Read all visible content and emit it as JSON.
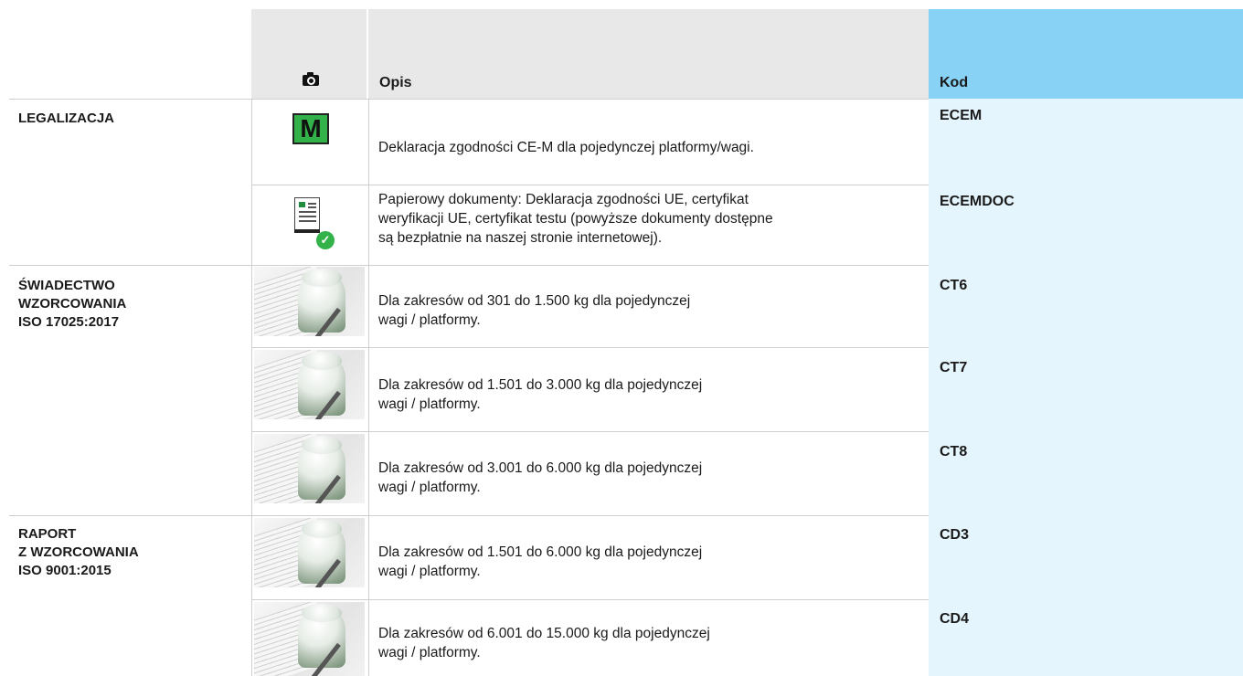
{
  "header": {
    "photo_icon": "camera-icon",
    "opis_label": "Opis",
    "kod_label": "Kod"
  },
  "colors": {
    "header_gray": "#e8e8e8",
    "header_blue": "#87d2f5",
    "kod_column": "#e5f5fd",
    "m_badge": "#33b24a",
    "check_green": "#34b24a"
  },
  "sections": [
    {
      "category": "LEGALIZACJA"
    },
    {
      "category": "ŚWIADECTWO\nWZORCOWANIA\nISO 17025:2017"
    },
    {
      "category": "RAPORT\nZ WZORCOWANIA\nISO 9001:2015"
    }
  ],
  "rows": [
    {
      "icon": "m-marking-icon",
      "description": "Deklaracja zgodności CE-M dla pojedynczej platformy/wagi.",
      "code": "ECEM"
    },
    {
      "icon": "document-check-icon",
      "description": "Papierowy dokumenty: Deklaracja zgodności UE, certyfikat\nweryfikacji UE, certyfikat testu (powyższe dokumenty dostępne\nsą bezpłatnie na naszej stronie internetowej).",
      "code": "ECEMDOC"
    },
    {
      "icon": "calibration-weight-photo",
      "description": "Dla zakresów od 301 do 1.500 kg dla pojedynczej\nwagi / platformy.",
      "code": "CT6"
    },
    {
      "icon": "calibration-weight-photo",
      "description": "Dla zakresów od 1.501 do 3.000 kg dla pojedynczej\nwagi / platformy.",
      "code": "CT7"
    },
    {
      "icon": "calibration-weight-photo",
      "description": "Dla zakresów od 3.001 do 6.000 kg dla pojedynczej\nwagi / platformy.",
      "code": "CT8"
    },
    {
      "icon": "calibration-weight-photo",
      "description": "Dla zakresów od 1.501 do 6.000 kg dla pojedynczej\nwagi / platformy.",
      "code": "CD3"
    },
    {
      "icon": "calibration-weight-photo",
      "description": "Dla zakresów od 6.001 do 15.000 kg dla pojedynczej\nwagi / platformy.",
      "code": "CD4"
    }
  ],
  "m_badge_letter": "M"
}
